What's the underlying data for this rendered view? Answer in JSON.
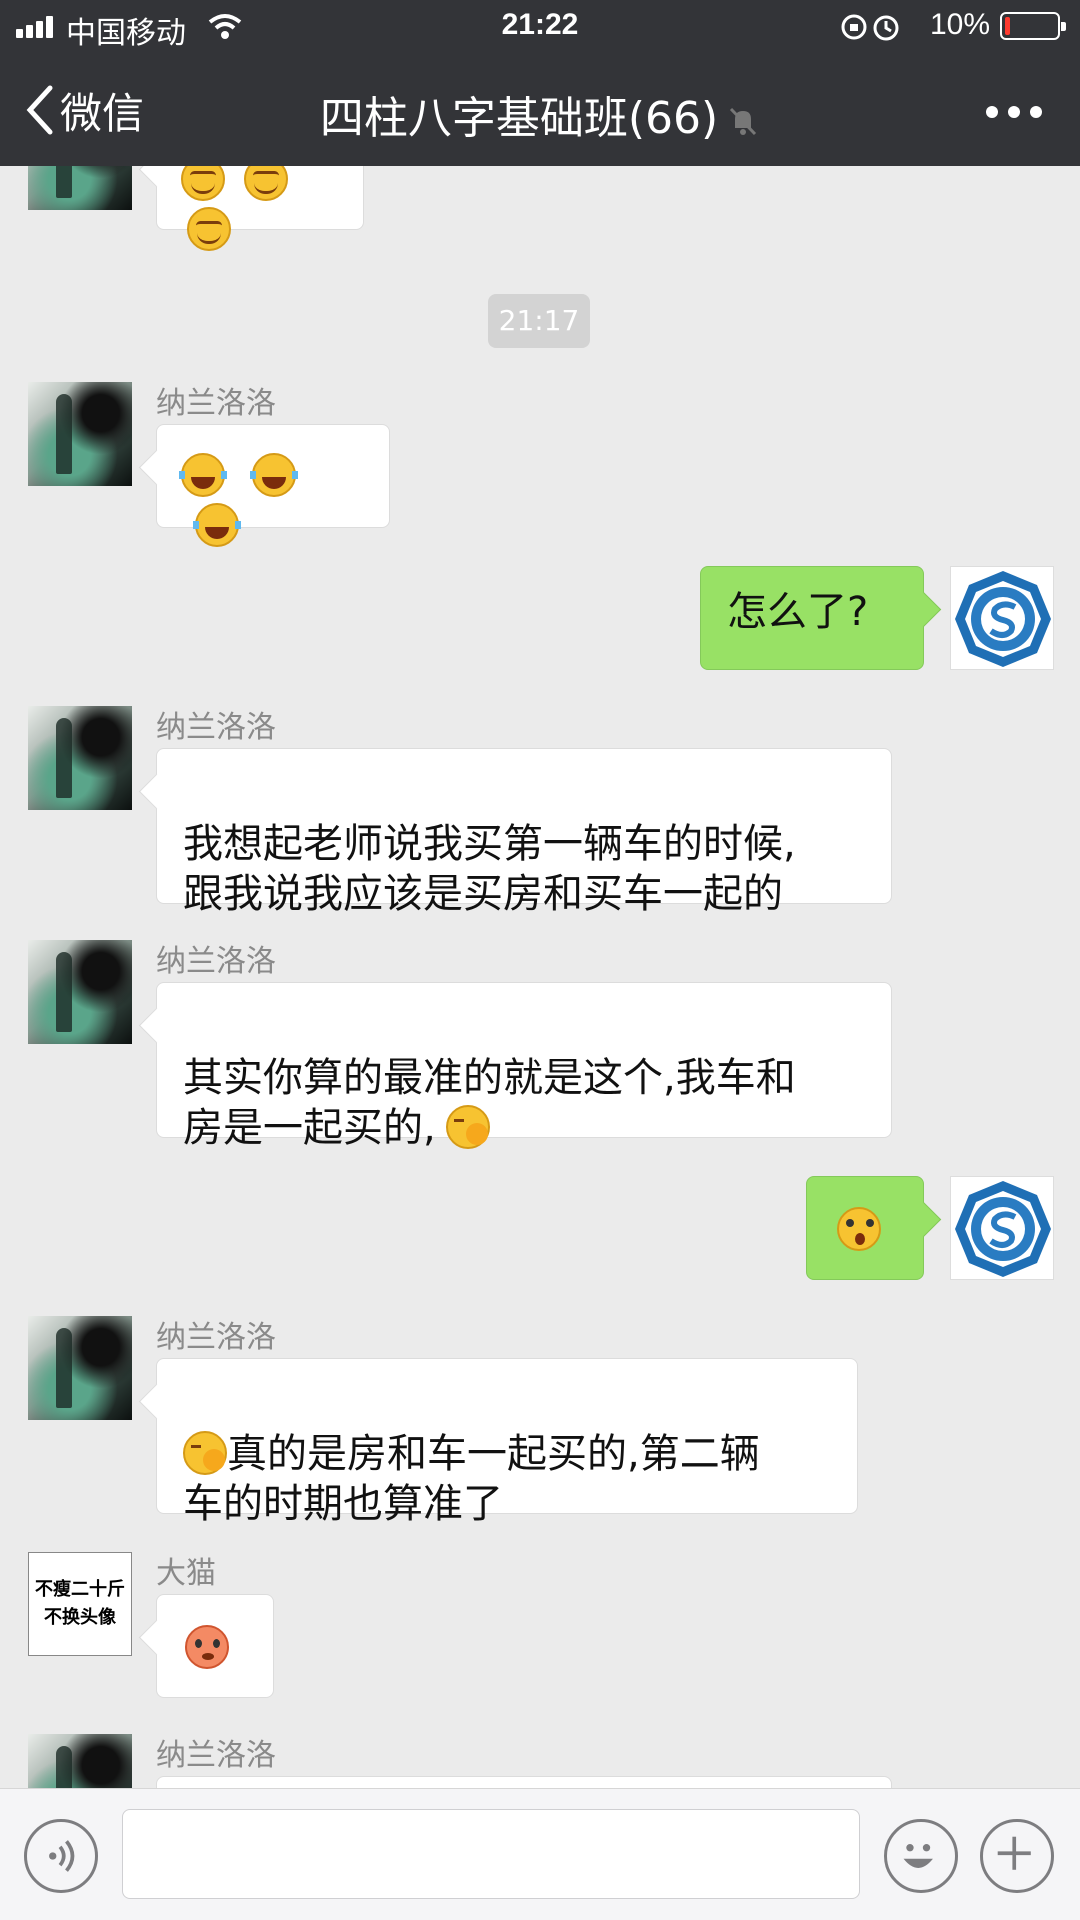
{
  "status_bar": {
    "carrier": "中国移动",
    "time": "21:22",
    "battery_percent": "10%",
    "battery_level": 0.1
  },
  "header": {
    "back_label": "微信",
    "title": "四柱八字基础班(66)",
    "icons": [
      "chevron-left-icon",
      "mute-bell-icon",
      "more-icon"
    ]
  },
  "chat": {
    "time_chip": "21:17",
    "messages": [
      {
        "sender": "纳兰洛洛",
        "text": "",
        "emoji": [
          "laugh-cry",
          "laugh-cry",
          "laugh-cry"
        ]
      },
      {
        "sender": "me",
        "text": "怎么了?"
      },
      {
        "sender": "纳兰洛洛",
        "text": "我想起老师说我买第一辆车的时候,\n跟我说我应该是买房和买车一起的"
      },
      {
        "sender": "纳兰洛洛",
        "text": "其实你算的最准的就是这个,我车和\n房是一起买的,",
        "emoji": [
          "face-palm"
        ]
      },
      {
        "sender": "me",
        "text": "",
        "emoji": [
          "shocked"
        ]
      },
      {
        "sender": "纳兰洛洛",
        "text": "真的是房和车一起买的,第二辆\n车的时期也算准了",
        "emoji": [
          "face-palm"
        ]
      },
      {
        "sender": "大猫",
        "text": "",
        "emoji": [
          "blush"
        ],
        "avatar_text": [
          "不瘦二十斤",
          "不换头像"
        ]
      },
      {
        "sender": "纳兰洛洛",
        "text": ""
      }
    ]
  },
  "input_bar": {
    "value": "",
    "icons": [
      "voice-icon",
      "emoji-icon",
      "plus-icon"
    ]
  }
}
